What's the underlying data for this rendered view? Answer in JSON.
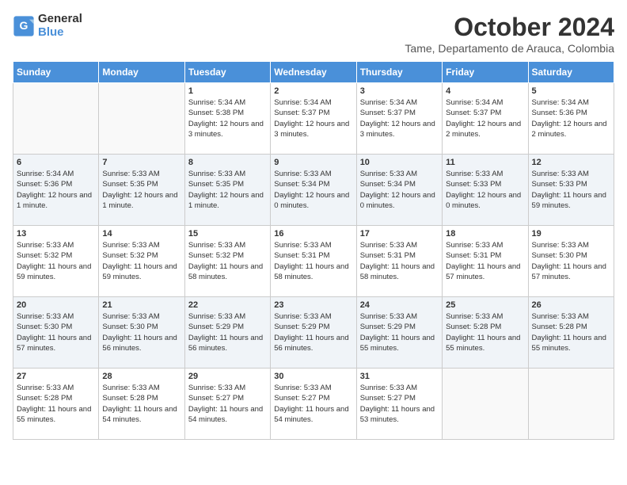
{
  "header": {
    "logo_line1": "General",
    "logo_line2": "Blue",
    "month": "October 2024",
    "location": "Tame, Departamento de Arauca, Colombia"
  },
  "weekdays": [
    "Sunday",
    "Monday",
    "Tuesday",
    "Wednesday",
    "Thursday",
    "Friday",
    "Saturday"
  ],
  "weeks": [
    [
      {
        "day": "",
        "info": ""
      },
      {
        "day": "",
        "info": ""
      },
      {
        "day": "1",
        "info": "Sunrise: 5:34 AM\nSunset: 5:38 PM\nDaylight: 12 hours and 3 minutes."
      },
      {
        "day": "2",
        "info": "Sunrise: 5:34 AM\nSunset: 5:37 PM\nDaylight: 12 hours and 3 minutes."
      },
      {
        "day": "3",
        "info": "Sunrise: 5:34 AM\nSunset: 5:37 PM\nDaylight: 12 hours and 3 minutes."
      },
      {
        "day": "4",
        "info": "Sunrise: 5:34 AM\nSunset: 5:37 PM\nDaylight: 12 hours and 2 minutes."
      },
      {
        "day": "5",
        "info": "Sunrise: 5:34 AM\nSunset: 5:36 PM\nDaylight: 12 hours and 2 minutes."
      }
    ],
    [
      {
        "day": "6",
        "info": "Sunrise: 5:34 AM\nSunset: 5:36 PM\nDaylight: 12 hours and 1 minute."
      },
      {
        "day": "7",
        "info": "Sunrise: 5:33 AM\nSunset: 5:35 PM\nDaylight: 12 hours and 1 minute."
      },
      {
        "day": "8",
        "info": "Sunrise: 5:33 AM\nSunset: 5:35 PM\nDaylight: 12 hours and 1 minute."
      },
      {
        "day": "9",
        "info": "Sunrise: 5:33 AM\nSunset: 5:34 PM\nDaylight: 12 hours and 0 minutes."
      },
      {
        "day": "10",
        "info": "Sunrise: 5:33 AM\nSunset: 5:34 PM\nDaylight: 12 hours and 0 minutes."
      },
      {
        "day": "11",
        "info": "Sunrise: 5:33 AM\nSunset: 5:33 PM\nDaylight: 12 hours and 0 minutes."
      },
      {
        "day": "12",
        "info": "Sunrise: 5:33 AM\nSunset: 5:33 PM\nDaylight: 11 hours and 59 minutes."
      }
    ],
    [
      {
        "day": "13",
        "info": "Sunrise: 5:33 AM\nSunset: 5:32 PM\nDaylight: 11 hours and 59 minutes."
      },
      {
        "day": "14",
        "info": "Sunrise: 5:33 AM\nSunset: 5:32 PM\nDaylight: 11 hours and 59 minutes."
      },
      {
        "day": "15",
        "info": "Sunrise: 5:33 AM\nSunset: 5:32 PM\nDaylight: 11 hours and 58 minutes."
      },
      {
        "day": "16",
        "info": "Sunrise: 5:33 AM\nSunset: 5:31 PM\nDaylight: 11 hours and 58 minutes."
      },
      {
        "day": "17",
        "info": "Sunrise: 5:33 AM\nSunset: 5:31 PM\nDaylight: 11 hours and 58 minutes."
      },
      {
        "day": "18",
        "info": "Sunrise: 5:33 AM\nSunset: 5:31 PM\nDaylight: 11 hours and 57 minutes."
      },
      {
        "day": "19",
        "info": "Sunrise: 5:33 AM\nSunset: 5:30 PM\nDaylight: 11 hours and 57 minutes."
      }
    ],
    [
      {
        "day": "20",
        "info": "Sunrise: 5:33 AM\nSunset: 5:30 PM\nDaylight: 11 hours and 57 minutes."
      },
      {
        "day": "21",
        "info": "Sunrise: 5:33 AM\nSunset: 5:30 PM\nDaylight: 11 hours and 56 minutes."
      },
      {
        "day": "22",
        "info": "Sunrise: 5:33 AM\nSunset: 5:29 PM\nDaylight: 11 hours and 56 minutes."
      },
      {
        "day": "23",
        "info": "Sunrise: 5:33 AM\nSunset: 5:29 PM\nDaylight: 11 hours and 56 minutes."
      },
      {
        "day": "24",
        "info": "Sunrise: 5:33 AM\nSunset: 5:29 PM\nDaylight: 11 hours and 55 minutes."
      },
      {
        "day": "25",
        "info": "Sunrise: 5:33 AM\nSunset: 5:28 PM\nDaylight: 11 hours and 55 minutes."
      },
      {
        "day": "26",
        "info": "Sunrise: 5:33 AM\nSunset: 5:28 PM\nDaylight: 11 hours and 55 minutes."
      }
    ],
    [
      {
        "day": "27",
        "info": "Sunrise: 5:33 AM\nSunset: 5:28 PM\nDaylight: 11 hours and 55 minutes."
      },
      {
        "day": "28",
        "info": "Sunrise: 5:33 AM\nSunset: 5:28 PM\nDaylight: 11 hours and 54 minutes."
      },
      {
        "day": "29",
        "info": "Sunrise: 5:33 AM\nSunset: 5:27 PM\nDaylight: 11 hours and 54 minutes."
      },
      {
        "day": "30",
        "info": "Sunrise: 5:33 AM\nSunset: 5:27 PM\nDaylight: 11 hours and 54 minutes."
      },
      {
        "day": "31",
        "info": "Sunrise: 5:33 AM\nSunset: 5:27 PM\nDaylight: 11 hours and 53 minutes."
      },
      {
        "day": "",
        "info": ""
      },
      {
        "day": "",
        "info": ""
      }
    ]
  ]
}
